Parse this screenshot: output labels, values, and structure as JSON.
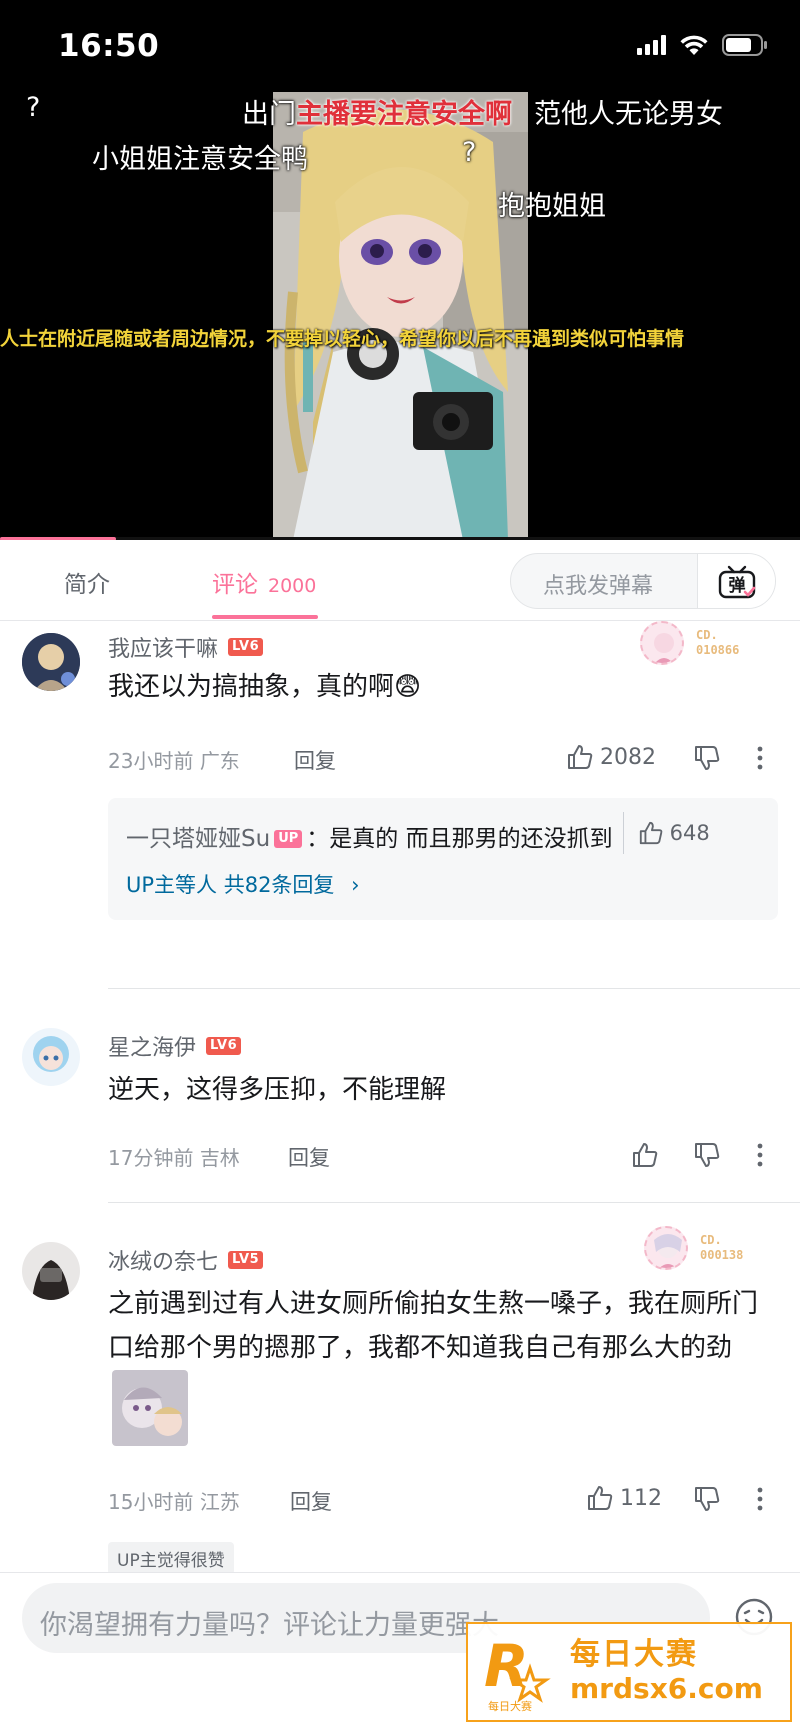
{
  "status": {
    "time": "16:50"
  },
  "video": {
    "danmaku": [
      {
        "text": "?",
        "style": "white"
      },
      {
        "text": "出门",
        "style": "white"
      },
      {
        "text": "主播要注意安全啊",
        "style": "red"
      },
      {
        "text": "范他人无论男女",
        "style": "white"
      },
      {
        "text": "小姐姐注意安全鸭",
        "style": "white"
      },
      {
        "text": "?",
        "style": "white"
      },
      {
        "text": "抱抱姐姐",
        "style": "white"
      }
    ],
    "subtitle": "人士在附近尾随或者周边情况，不要掉以轻心，希望你以后不再遇到类似可怕事情",
    "progress_fraction": 0.145
  },
  "tabs": {
    "intro": "简介",
    "comments": "评论",
    "comment_count": "2000",
    "danmaku_placeholder": "点我发弹幕",
    "danmaku_button_glyph": "弹"
  },
  "comments": [
    {
      "username": "我应该干嘛",
      "level": "LV6",
      "badge": {
        "line1": "CD.",
        "line2": "010866"
      },
      "text": "我还以为搞抽象，真的啊😨",
      "time": "23小时前",
      "location": "广东",
      "reply_label": "回复",
      "likes": "2082",
      "replies": {
        "user": "一只塔娅娅Su",
        "up_tag": "UP",
        "text": "：是真的 而且那男的还没抓到",
        "likes": "648",
        "more": "UP主等人 共82条回复"
      }
    },
    {
      "username": "星之海伊",
      "level": "LV6",
      "text": "逆天，这得多压抑，不能理解",
      "time": "17分钟前",
      "location": "吉林",
      "reply_label": "回复"
    },
    {
      "username": "冰绒の奈七",
      "level": "LV5",
      "badge": {
        "line1": "CD.",
        "line2": "000138"
      },
      "text_part1": "之前遇到过有人进女厕所偷拍女生熬一嗓子，我在厕所门口给那个男的摁那了，我都不知道我自己有那么大的劲",
      "time": "15小时前",
      "location": "江苏",
      "reply_label": "回复",
      "likes": "112",
      "up_liked": "UP主觉得很赞"
    }
  ],
  "bottom": {
    "placeholder": "你渴望拥有力量吗？评论让力量更强大"
  },
  "watermark": {
    "title": "每日大赛",
    "url": "mrdsx6.com",
    "logo_letter": "R",
    "logo_caption": "每日大赛"
  },
  "colors": {
    "accent_pink": "#fb7299",
    "subtitle_yellow": "#f2d33a",
    "level_red": "#f05a4e",
    "link_blue": "#00699d",
    "watermark_orange": "#f29a12"
  }
}
